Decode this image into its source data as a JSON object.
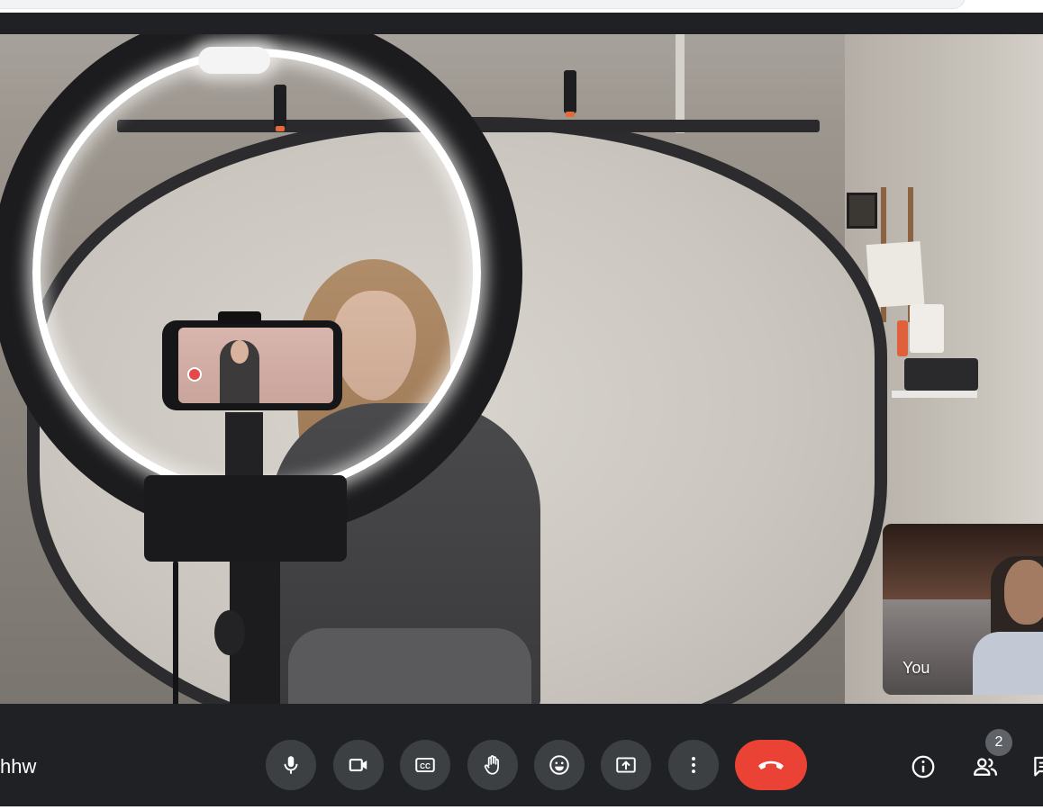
{
  "self_view": {
    "label": "You"
  },
  "meeting": {
    "code_fragment": "hhw"
  },
  "participants": {
    "count": "2"
  },
  "colors": {
    "bar_background": "#202124",
    "button_background": "#3c4043",
    "end_call": "#ea4335",
    "icon": "#ffffff",
    "badge": "#5f6368"
  },
  "controls": [
    {
      "name": "microphone",
      "icon": "mic-icon"
    },
    {
      "name": "camera",
      "icon": "videocam-icon"
    },
    {
      "name": "captions",
      "icon": "closed-caption-icon"
    },
    {
      "name": "raise-hand",
      "icon": "hand-icon"
    },
    {
      "name": "reactions",
      "icon": "smiley-icon"
    },
    {
      "name": "present",
      "icon": "present-screen-icon"
    },
    {
      "name": "more-options",
      "icon": "more-vert-icon"
    },
    {
      "name": "leave-call",
      "icon": "call-end-icon"
    }
  ],
  "side_controls": [
    {
      "name": "meeting-details",
      "icon": "info-icon"
    },
    {
      "name": "people",
      "icon": "people-icon"
    },
    {
      "name": "chat",
      "icon": "chat-icon"
    }
  ]
}
